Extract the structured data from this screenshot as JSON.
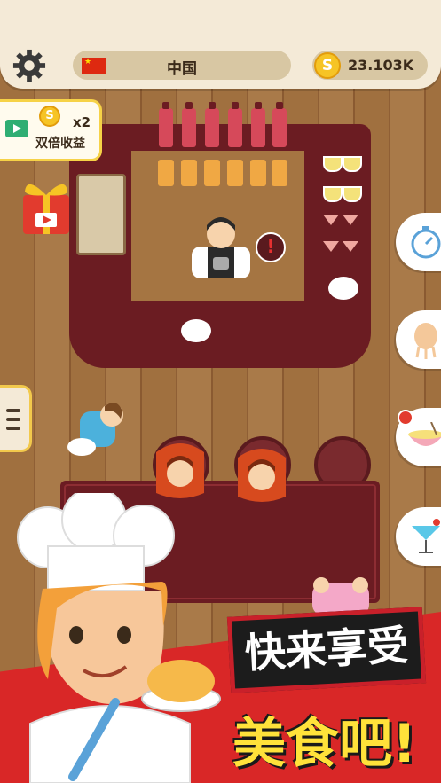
{
  "header": {
    "country": "中国",
    "flag": "china-flag",
    "coins": "23.103K",
    "coin_symbol": "S"
  },
  "double_income": {
    "multiplier": "x2",
    "label": "双倍收益",
    "coin_symbol": "S"
  },
  "slogan": {
    "line1": "快来享受",
    "line2": "美食吧!"
  },
  "alert_mark": "!",
  "icons": [
    "gear-icon",
    "video-icon",
    "gift-icon",
    "stopwatch-icon",
    "chef-upgrade-icon",
    "noodle-bowl-icon",
    "cocktail-icon",
    "menu-icon"
  ],
  "colors": {
    "accent": "#f2c94c",
    "counter": "#6b1c22",
    "banner": "#d92727",
    "slogan_yellow": "#ffe23a"
  }
}
